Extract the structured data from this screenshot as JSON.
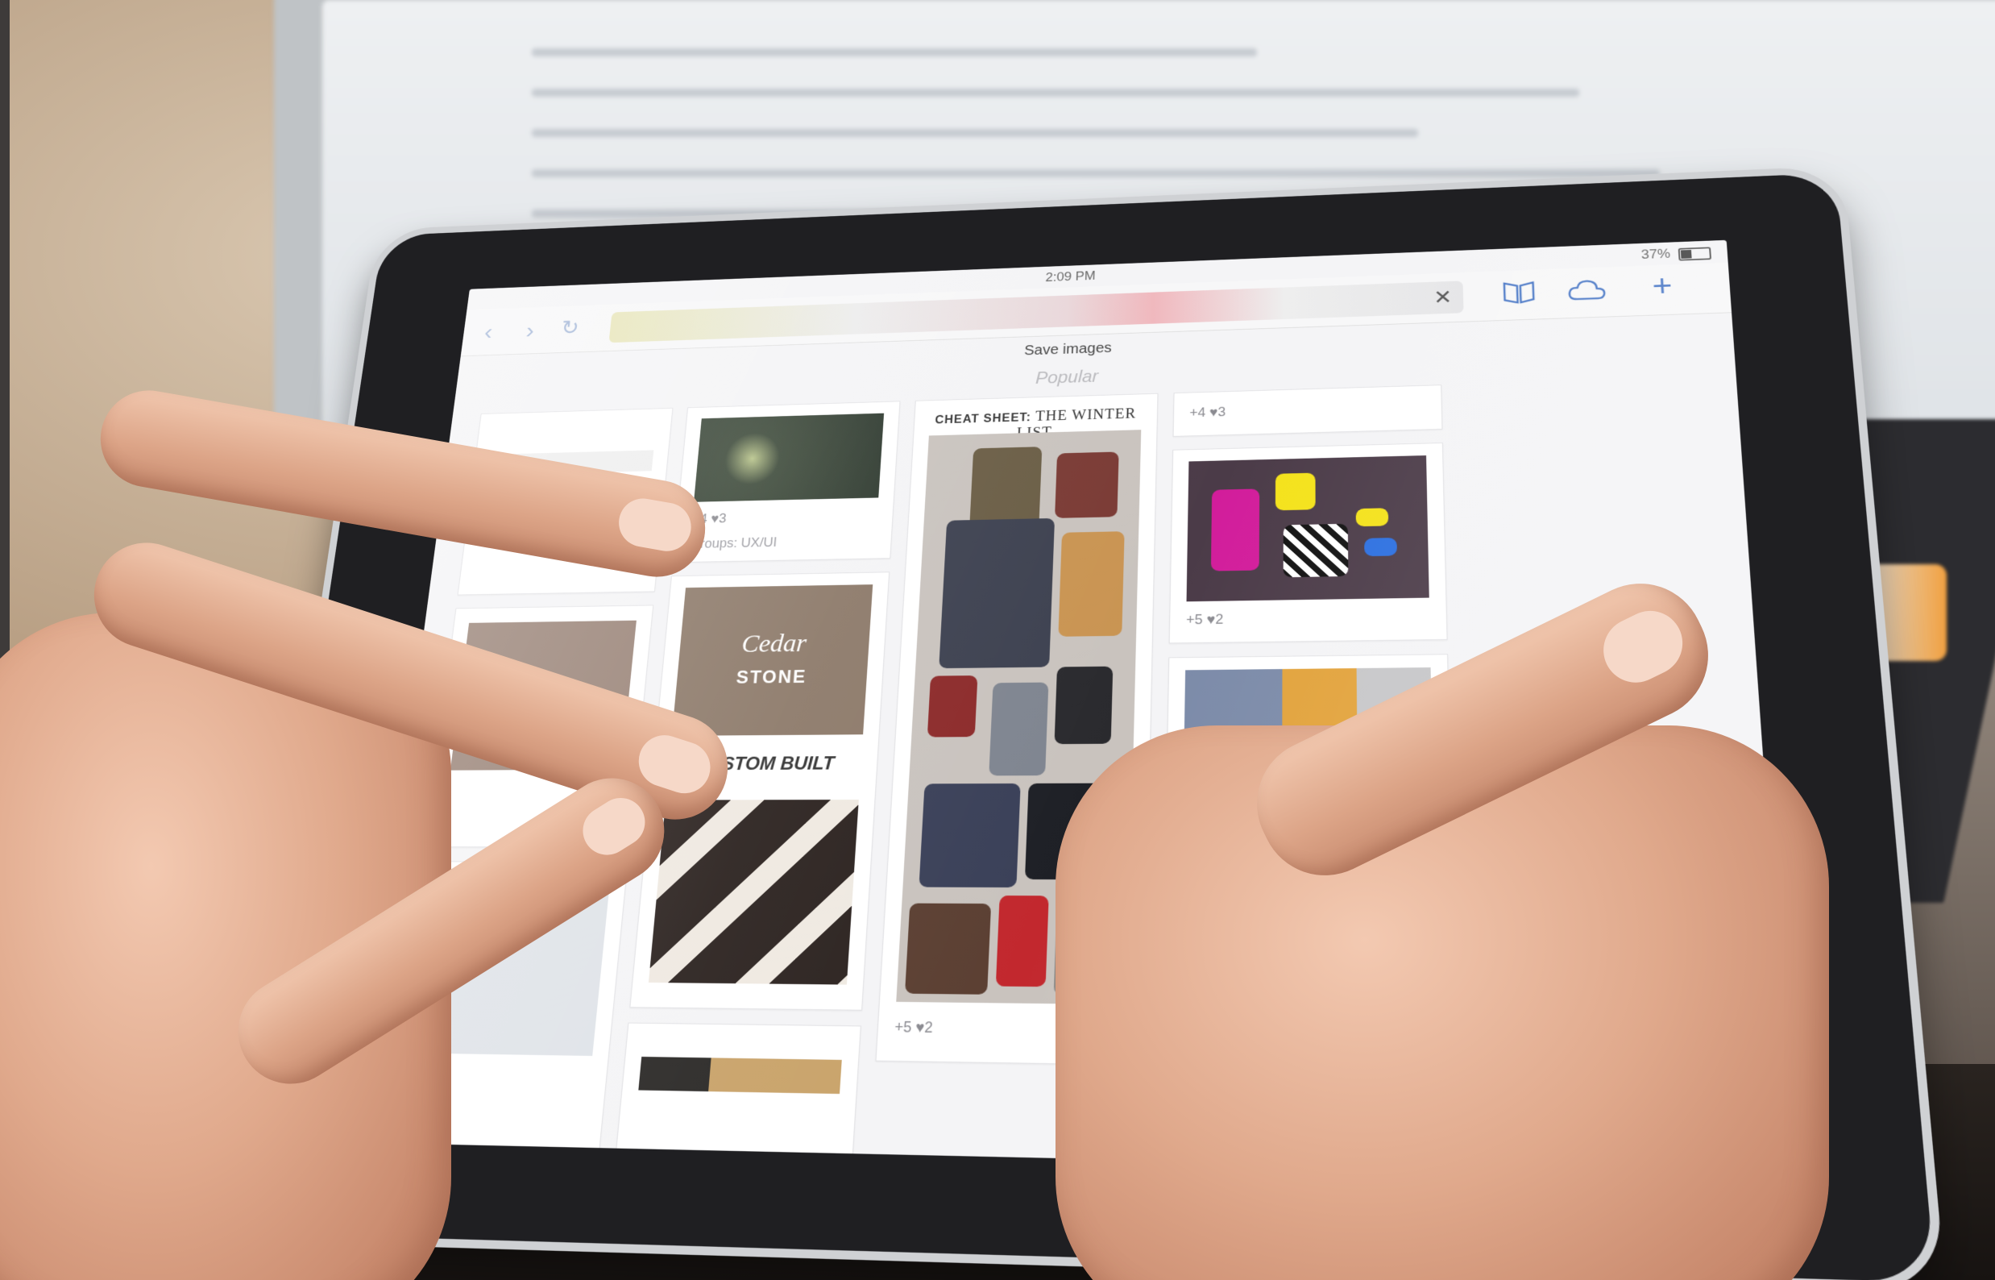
{
  "status_bar": {
    "time": "2:09 PM",
    "battery": "37%",
    "battery_level": 0.37
  },
  "toolbar": {
    "back_icon": "chevron-left-icon",
    "forward_icon": "chevron-right-icon",
    "reload_icon": "reload-icon",
    "clear_icon": "close-icon",
    "clear_symbol": "✕",
    "bookmarks_icon": "book-icon",
    "cloud_icon": "cloud-icon",
    "add_icon": "plus-icon",
    "add_symbol": "+"
  },
  "page": {
    "title": "Save images",
    "section": "Popular"
  },
  "cards": {
    "twitter_meta": "+4 ♥3",
    "twitter_group": "Groups: UX/UI",
    "cedar_line1": "Cedar",
    "cedar_line2": "STONE",
    "custom_built": "CUSTOM BUILT",
    "cheat_sheet_prefix": "CHEAT SHEET:",
    "cheat_sheet_title": "THE WINTER LIST",
    "cheat_meta": "+5 ♥2",
    "colorful_top_meta": "+4 ♥3",
    "colorful_meta": "+5 ♥2"
  },
  "colors": {
    "accent_blue": "#4a78c6",
    "screen_bg": "#f4f4f6",
    "bezel": "#1f1f22"
  }
}
